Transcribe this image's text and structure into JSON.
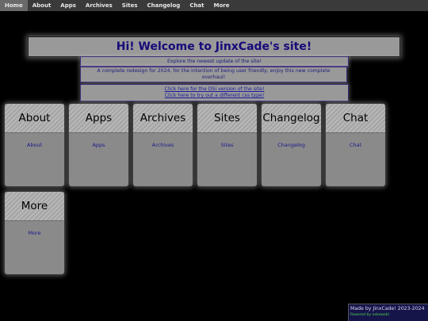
{
  "nav": {
    "items": [
      "Home",
      "About",
      "Apps",
      "Archives",
      "Sites",
      "Changelog",
      "Chat",
      "More"
    ]
  },
  "banner": {
    "title": "Hi! Welcome to JinxCade's site!"
  },
  "info": {
    "update": "Explore the newest update of the site!",
    "redesign": "A complete redesign for 2024, for the intention of being user friendly, enjoy this new complete overhaul!",
    "dsi_link": "Click here for the DSi version of the site!",
    "css_link": "Click here to try out a different css type!"
  },
  "cards": [
    {
      "title": "About",
      "link": "About"
    },
    {
      "title": "Apps",
      "link": "Apps"
    },
    {
      "title": "Archives",
      "link": "Archives"
    },
    {
      "title": "Sites",
      "link": "Sites"
    },
    {
      "title": "Changelog",
      "link": "Changelog"
    },
    {
      "title": "Chat",
      "link": "Chat"
    },
    {
      "title": "More",
      "link": "More"
    }
  ],
  "footer": {
    "made_by": "Made by JinxCade! 2023-2024",
    "powered": "Powered by nekoweb!"
  },
  "colors": {
    "background": "#000000",
    "panel": "#999999",
    "title_text": "#160a7a",
    "link_text": "#1c1a8a"
  }
}
